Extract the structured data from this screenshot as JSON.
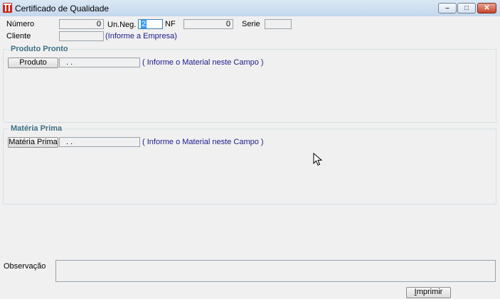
{
  "window": {
    "title": "Certificado de Qualidade",
    "min_symbol": "–",
    "max_symbol": "□",
    "close_symbol": "✕"
  },
  "header": {
    "numero_label": "Número",
    "numero_value": "0",
    "unneg_label": "Un.Neg.",
    "unneg_value": "2",
    "nf_label": "NF",
    "nf_value": "0",
    "serie_label": "Serie",
    "serie_value": "",
    "cliente_label": "Cliente",
    "cliente_value": "",
    "cliente_hint": "(Informe a Empresa)"
  },
  "produto_pronto": {
    "title": "Produto Pronto",
    "button_label": "Produto",
    "field_value": ". .",
    "hint": "( Informe o Material neste Campo )"
  },
  "materia_prima": {
    "title": "Matéria Prima",
    "button_label": "Matéria Prima",
    "field_value": ". .",
    "hint": "( Informe o Material neste Campo )"
  },
  "observacao": {
    "label": "Observação",
    "value": ""
  },
  "footer": {
    "print_button_first": "I",
    "print_button_rest": "mprimir"
  },
  "colors": {
    "group_title": "#3d6f87",
    "hint_text": "#1a1a8c",
    "close_button": "#c4452c"
  }
}
